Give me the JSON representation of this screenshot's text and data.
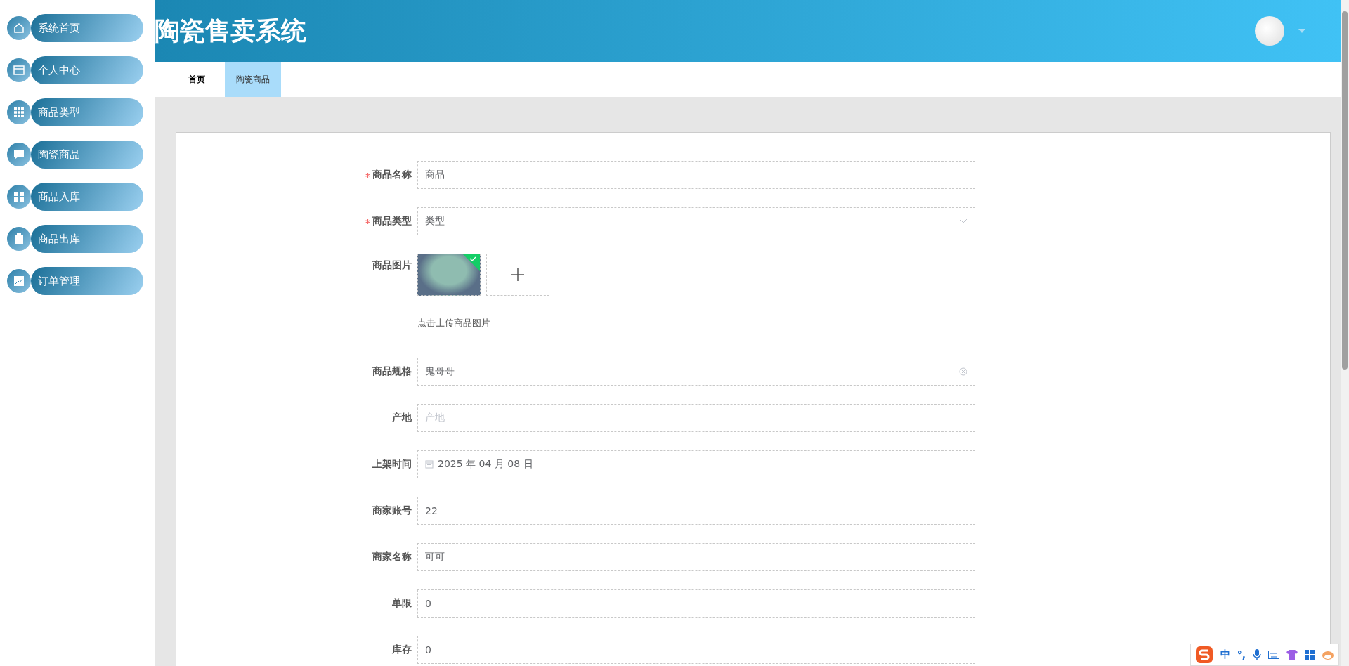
{
  "sidebar": {
    "items": [
      {
        "label": "系统首页",
        "selected": false
      },
      {
        "label": "个人中心",
        "selected": false
      },
      {
        "label": "商品类型",
        "selected": false
      },
      {
        "label": "陶瓷商品",
        "selected": false
      },
      {
        "label": "商品入库",
        "selected": false
      },
      {
        "label": "商品出库",
        "selected": false
      },
      {
        "label": "订单管理",
        "selected": false
      }
    ]
  },
  "header": {
    "title": "陶瓷售卖系统"
  },
  "tabs": [
    {
      "label": "首页",
      "selected": false
    },
    {
      "label": "陶瓷商品",
      "selected": true
    }
  ],
  "form": {
    "fields": [
      {
        "kind": "text",
        "label": "商品名称",
        "required": true,
        "value": "商品"
      },
      {
        "kind": "select",
        "label": "商品类型",
        "required": true,
        "value": "类型"
      },
      {
        "kind": "image",
        "label": "商品图片",
        "required": false,
        "uploaded": true,
        "hint": "点击上传商品图片"
      },
      {
        "kind": "text",
        "label": "商品规格",
        "required": false,
        "value": "鬼哥哥",
        "clearable": true
      },
      {
        "kind": "text",
        "label": "产地",
        "required": false,
        "placeholder": "产地"
      },
      {
        "kind": "date",
        "label": "上架时间",
        "required": false,
        "value": "2025 年 04 月 08 日"
      },
      {
        "kind": "text",
        "label": "商家账号",
        "required": false,
        "value": "22"
      },
      {
        "kind": "text",
        "label": "商家名称",
        "required": false,
        "value": "可可"
      },
      {
        "kind": "text",
        "label": "单限",
        "required": false,
        "value": "0"
      },
      {
        "kind": "text",
        "label": "库存",
        "required": false,
        "value": "0"
      }
    ]
  },
  "ime_bar": {
    "items": [
      "中",
      "°,"
    ]
  }
}
